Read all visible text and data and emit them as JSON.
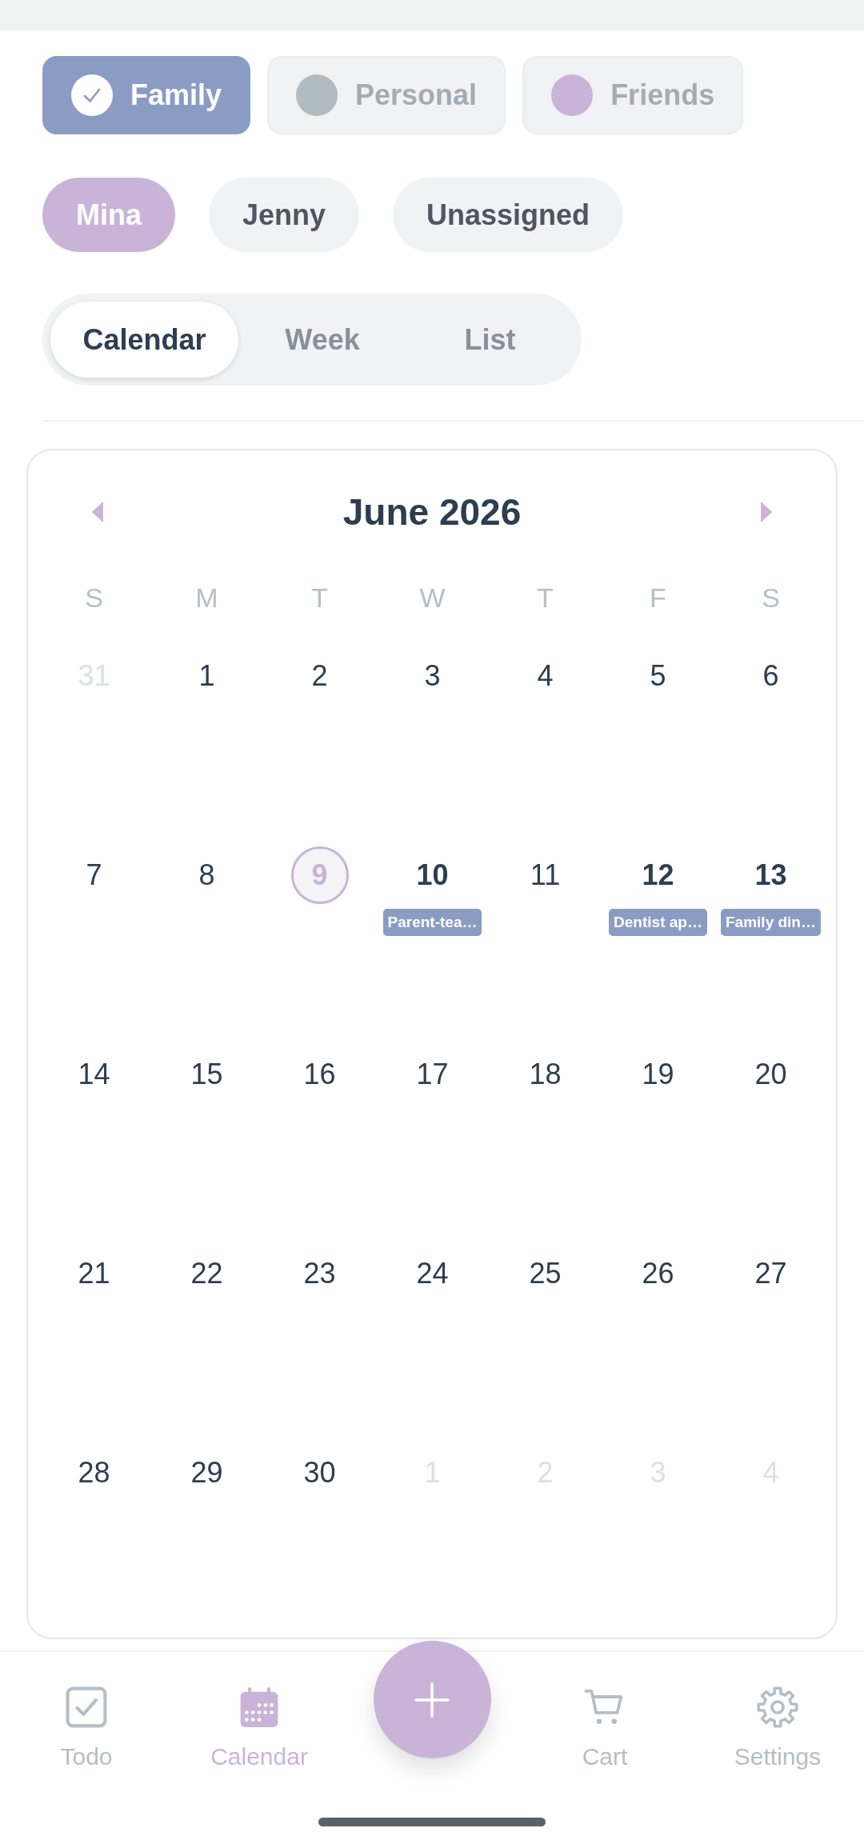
{
  "categories": [
    {
      "label": "Family",
      "color": "#8b9cc4",
      "selected": true
    },
    {
      "label": "Personal",
      "color": "#b0bcc2",
      "selected": false
    },
    {
      "label": "Friends",
      "color": "#c9b4d8",
      "selected": false
    }
  ],
  "members": [
    {
      "label": "Mina",
      "selected": true
    },
    {
      "label": "Jenny",
      "selected": false
    },
    {
      "label": "Unassigned",
      "selected": false
    }
  ],
  "view_tabs": [
    {
      "label": "Calendar",
      "selected": true
    },
    {
      "label": "Week",
      "selected": false
    },
    {
      "label": "List",
      "selected": false
    }
  ],
  "calendar": {
    "title": "June 2026",
    "weekdays": [
      "S",
      "M",
      "T",
      "W",
      "T",
      "F",
      "S"
    ],
    "weeks": [
      [
        {
          "day": "31",
          "outside": true,
          "today": false
        },
        {
          "day": "1",
          "outside": false,
          "today": false
        },
        {
          "day": "2",
          "outside": false,
          "today": false
        },
        {
          "day": "3",
          "outside": false,
          "today": false
        },
        {
          "day": "4",
          "outside": false,
          "today": false
        },
        {
          "day": "5",
          "outside": false,
          "today": false
        },
        {
          "day": "6",
          "outside": false,
          "today": false
        }
      ],
      [
        {
          "day": "7",
          "outside": false,
          "today": false
        },
        {
          "day": "8",
          "outside": false,
          "today": false
        },
        {
          "day": "9",
          "outside": false,
          "today": true
        },
        {
          "day": "10",
          "outside": false,
          "today": false,
          "events": [
            "Parent-tea…"
          ]
        },
        {
          "day": "11",
          "outside": false,
          "today": false
        },
        {
          "day": "12",
          "outside": false,
          "today": false,
          "events": [
            "Dentist ap…"
          ]
        },
        {
          "day": "13",
          "outside": false,
          "today": false,
          "events": [
            "Family din…"
          ]
        }
      ],
      [
        {
          "day": "14",
          "outside": false,
          "today": false
        },
        {
          "day": "15",
          "outside": false,
          "today": false
        },
        {
          "day": "16",
          "outside": false,
          "today": false
        },
        {
          "day": "17",
          "outside": false,
          "today": false
        },
        {
          "day": "18",
          "outside": false,
          "today": false
        },
        {
          "day": "19",
          "outside": false,
          "today": false
        },
        {
          "day": "20",
          "outside": false,
          "today": false
        }
      ],
      [
        {
          "day": "21",
          "outside": false,
          "today": false
        },
        {
          "day": "22",
          "outside": false,
          "today": false
        },
        {
          "day": "23",
          "outside": false,
          "today": false
        },
        {
          "day": "24",
          "outside": false,
          "today": false
        },
        {
          "day": "25",
          "outside": false,
          "today": false
        },
        {
          "day": "26",
          "outside": false,
          "today": false
        },
        {
          "day": "27",
          "outside": false,
          "today": false
        }
      ],
      [
        {
          "day": "28",
          "outside": false,
          "today": false
        },
        {
          "day": "29",
          "outside": false,
          "today": false
        },
        {
          "day": "30",
          "outside": false,
          "today": false
        },
        {
          "day": "1",
          "outside": true,
          "today": false
        },
        {
          "day": "2",
          "outside": true,
          "today": false
        },
        {
          "day": "3",
          "outside": true,
          "today": false
        },
        {
          "day": "4",
          "outside": true,
          "today": false
        }
      ]
    ]
  },
  "bottom_nav": {
    "tabs": [
      {
        "label": "Todo",
        "selected": false
      },
      {
        "label": "Calendar",
        "selected": true
      },
      {
        "label": "Cart",
        "selected": false
      },
      {
        "label": "Settings",
        "selected": false
      }
    ]
  }
}
